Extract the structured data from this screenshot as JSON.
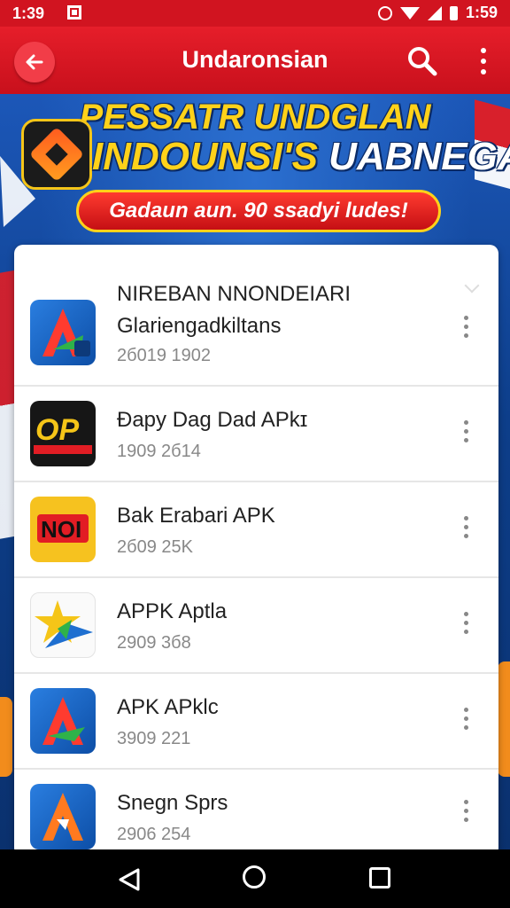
{
  "status_bar": {
    "time_left": "1:39",
    "time_right": "1:59"
  },
  "app_bar": {
    "title": "Undaronsian"
  },
  "banner": {
    "line1": "PESSATR UNDGLAN",
    "line2_part1": "INDOUNSI'S",
    "line2_part2": "UABNEGA",
    "pill": "Gadaun aun. 90 ssadyi ludes!"
  },
  "list": {
    "items": [
      {
        "title": "NIREBAN NNONDEIARI",
        "subtitle": "Glariengadkiltans",
        "meta": "2б019 1902",
        "icon": "a-triangle-icon"
      },
      {
        "title": "Đapy Dag Dad APkɪ",
        "meta": "1909 2б14",
        "icon": "op-logo-icon"
      },
      {
        "title": "Bak Erabari APK",
        "meta": "2б09 25K",
        "icon": "noi-logo-icon"
      },
      {
        "title": "APPK Aptla",
        "meta": "2909 3б8",
        "icon": "star-arrow-icon"
      },
      {
        "title": "APK APklc",
        "meta": "3909 221",
        "icon": "a-triangle-icon"
      },
      {
        "title": "Snegn Sprs",
        "meta": "2906 254",
        "icon": "a-triangle-icon"
      }
    ]
  },
  "colors": {
    "primary": "#d11420",
    "banner": "#1c57b8",
    "accent": "#ffd21a"
  }
}
